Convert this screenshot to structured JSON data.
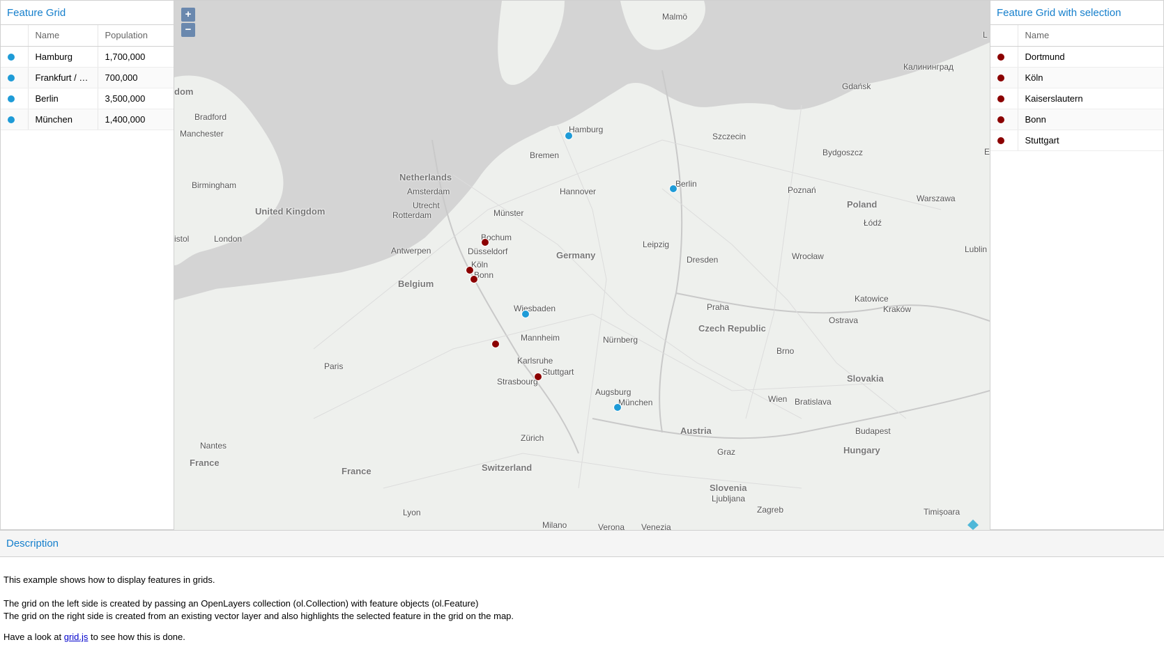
{
  "left_grid": {
    "title": "Feature Grid",
    "columns": [
      "",
      "Name",
      "Population"
    ],
    "rows": [
      {
        "name": "Hamburg",
        "population": "1,700,000"
      },
      {
        "name": "Frankfurt / Main",
        "population": "700,000"
      },
      {
        "name": "Berlin",
        "population": "3,500,000"
      },
      {
        "name": "München",
        "population": "1,400,000"
      }
    ],
    "dot_color": "#1e9bd7"
  },
  "right_grid": {
    "title": "Feature Grid with selection",
    "columns": [
      "",
      "Name"
    ],
    "rows": [
      {
        "name": "Dortmund"
      },
      {
        "name": "Köln"
      },
      {
        "name": "Kaiserslautern"
      },
      {
        "name": "Bonn"
      },
      {
        "name": "Stuttgart"
      }
    ],
    "dot_color": "#8b0000"
  },
  "map": {
    "zoom_in": "+",
    "zoom_out": "−",
    "labels": {
      "malmo": "Malmö",
      "kaliningrad": "Калининград",
      "gdansk": "Gdańsk",
      "hamburg": "Hamburg",
      "bremen": "Bremen",
      "szczecin": "Szczecin",
      "bydgoszcz": "Bydgoszcz",
      "berlin": "Berlin",
      "poznan": "Poznań",
      "warszawa": "Warszawa",
      "lodz": "Łódź",
      "poland": "Poland",
      "netherlands": "Netherlands",
      "amsterdam": "Amsterdam",
      "utrecht": "Utrecht",
      "rotterdam": "Rotterdam",
      "hannover": "Hannover",
      "munster": "Münster",
      "bochum": "Bochum",
      "dusseldorf": "Düsseldorf",
      "koln": "Köln",
      "bonn": "Bonn",
      "antwerpen": "Antwerpen",
      "belgium": "Belgium",
      "germany": "Germany",
      "leipzig": "Leipzig",
      "dresden": "Dresden",
      "wroclaw": "Wrocław",
      "lublin": "Lublin",
      "katowice": "Katowice",
      "krakow": "Kraków",
      "ostrava": "Ostrava",
      "praha": "Praha",
      "czech": "Czech Republic",
      "brno": "Brno",
      "wiesbaden": "Wiesbaden",
      "mannheim": "Mannheim",
      "nurnberg": "Nürnberg",
      "karlsruhe": "Karlsruhe",
      "stuttgart": "Stuttgart",
      "strasbourg": "Strasbourg",
      "augsburg": "Augsburg",
      "munchen": "München",
      "wien": "Wien",
      "bratislava": "Bratislava",
      "slovakia": "Slovakia",
      "budapest": "Budapest",
      "hungary": "Hungary",
      "austria": "Austria",
      "graz": "Graz",
      "slovenia": "Slovenia",
      "ljubljana": "Ljubljana",
      "zagreb": "Zagreb",
      "timisoara": "Timișoara",
      "zurich": "Zürich",
      "switzerland": "Switzerland",
      "france1": "France",
      "france2": "France",
      "paris": "Paris",
      "nantes": "Nantes",
      "lyon": "Lyon",
      "milano": "Milano",
      "verona": "Verona",
      "venezia": "Venezia",
      "uk": "United Kingdom",
      "london": "London",
      "birmingham": "Birmingham",
      "manchester": "Manchester",
      "bradford": "Bradford",
      "dom": "dom",
      "istol": "istol",
      "edge_l": "L",
      "edge_e": "E"
    }
  },
  "description": {
    "title": "Description",
    "p1": "This example shows how to display features in grids.",
    "p2": "The grid on the left side is created by passing an OpenLayers collection (ol.Collection) with feature objects (ol.Feature)",
    "p3": "The grid on the right side is created from an existing vector layer and also highlights the selected feature in the grid on the map.",
    "p4_before": "Have a look at ",
    "p4_link": "grid.js",
    "p4_after": " to see how this is done."
  }
}
